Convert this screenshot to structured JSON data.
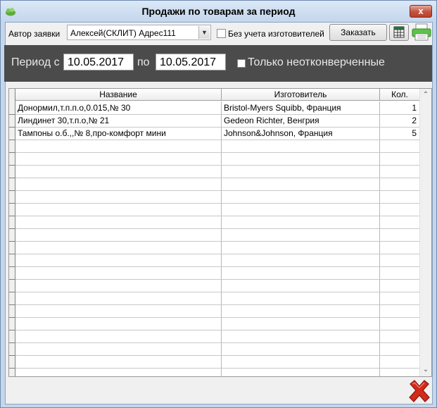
{
  "window": {
    "title": "Продажи по товарам за период",
    "close_label": "x"
  },
  "toolbar": {
    "author_label": "Автор заявки",
    "author_value": "Алексей(СКЛИТ) Адрес111",
    "ignore_makers_label": "Без учета изготовителей",
    "order_label": "Заказать"
  },
  "period": {
    "from_label": "Период с",
    "from_value": "10.05.2017",
    "to_label": "по",
    "to_value": "10.05.2017",
    "unconverted_label": "Только неотконверченные"
  },
  "table": {
    "columns": [
      "Название",
      "Изготовитель",
      "Кол."
    ],
    "rows": [
      [
        "Донормил,т.п.п.о,0.015,№ 30",
        "Bristol-Myers Squibb, Франция",
        "1"
      ],
      [
        "Линдинет 30,т.п.о,№ 21",
        "Gedeon Richter, Венгрия",
        "2"
      ],
      [
        "Тампоны о.б.,,№ 8,про-комфорт мини",
        "Johnson&Johnson, Франция",
        "5"
      ]
    ]
  },
  "colors": {
    "title_bar": "#c4d7ea",
    "period_panel": "#4b4b4b",
    "delete_red": "#d42a1a"
  }
}
